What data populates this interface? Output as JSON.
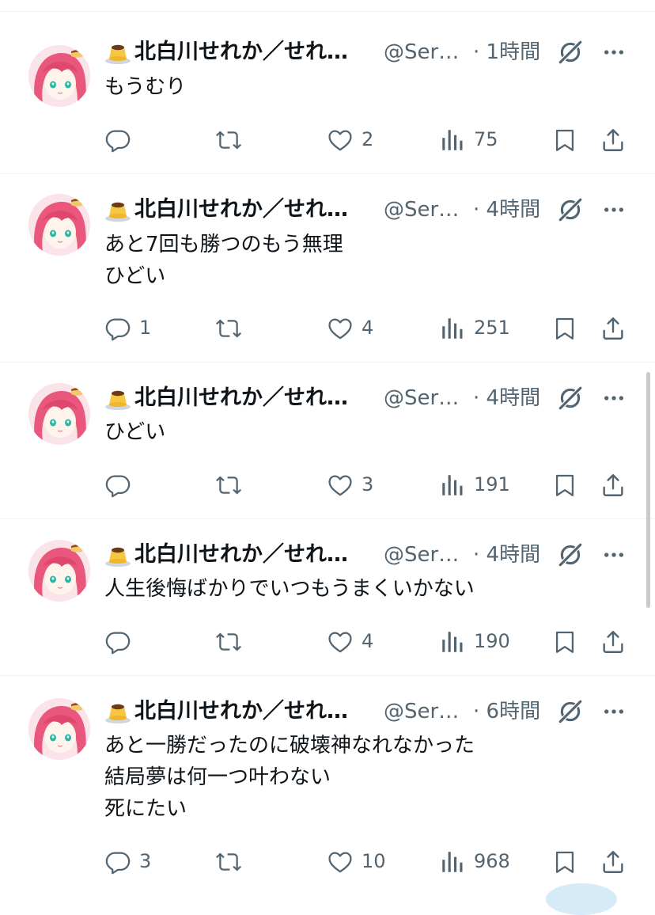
{
  "colors": {
    "text": "#0f1419",
    "secondary": "#536471",
    "divider": "#eff3f4"
  },
  "tweets": [
    {
      "name": "北白川せれか／せれ…",
      "handle": "@Ser…",
      "time": "· 1時間",
      "lines": [
        "もうむり"
      ],
      "replies": "",
      "retweets": "",
      "likes": "2",
      "views": "75"
    },
    {
      "name": "北白川せれか／せれ…",
      "handle": "@Ser…",
      "time": "· 4時間",
      "lines": [
        "あと7回も勝つのもう無理",
        "ひどい"
      ],
      "replies": "1",
      "retweets": "",
      "likes": "4",
      "views": "251"
    },
    {
      "name": "北白川せれか／せれ…",
      "handle": "@Ser…",
      "time": "· 4時間",
      "lines": [
        "ひどい"
      ],
      "replies": "",
      "retweets": "",
      "likes": "3",
      "views": "191"
    },
    {
      "name": "北白川せれか／せれ…",
      "handle": "@Ser…",
      "time": "· 4時間",
      "lines": [
        "人生後悔ばかりでいつもうまくいかない"
      ],
      "replies": "",
      "retweets": "",
      "likes": "4",
      "views": "190"
    },
    {
      "name": "北白川せれか／せれ…",
      "handle": "@Ser…",
      "time": "· 6時間",
      "lines": [
        "あと一勝だったのに破壊神なれなかった",
        "結局夢は何一つ叶わない",
        "死にたい"
      ],
      "replies": "3",
      "retweets": "",
      "likes": "10",
      "views": "968"
    }
  ]
}
